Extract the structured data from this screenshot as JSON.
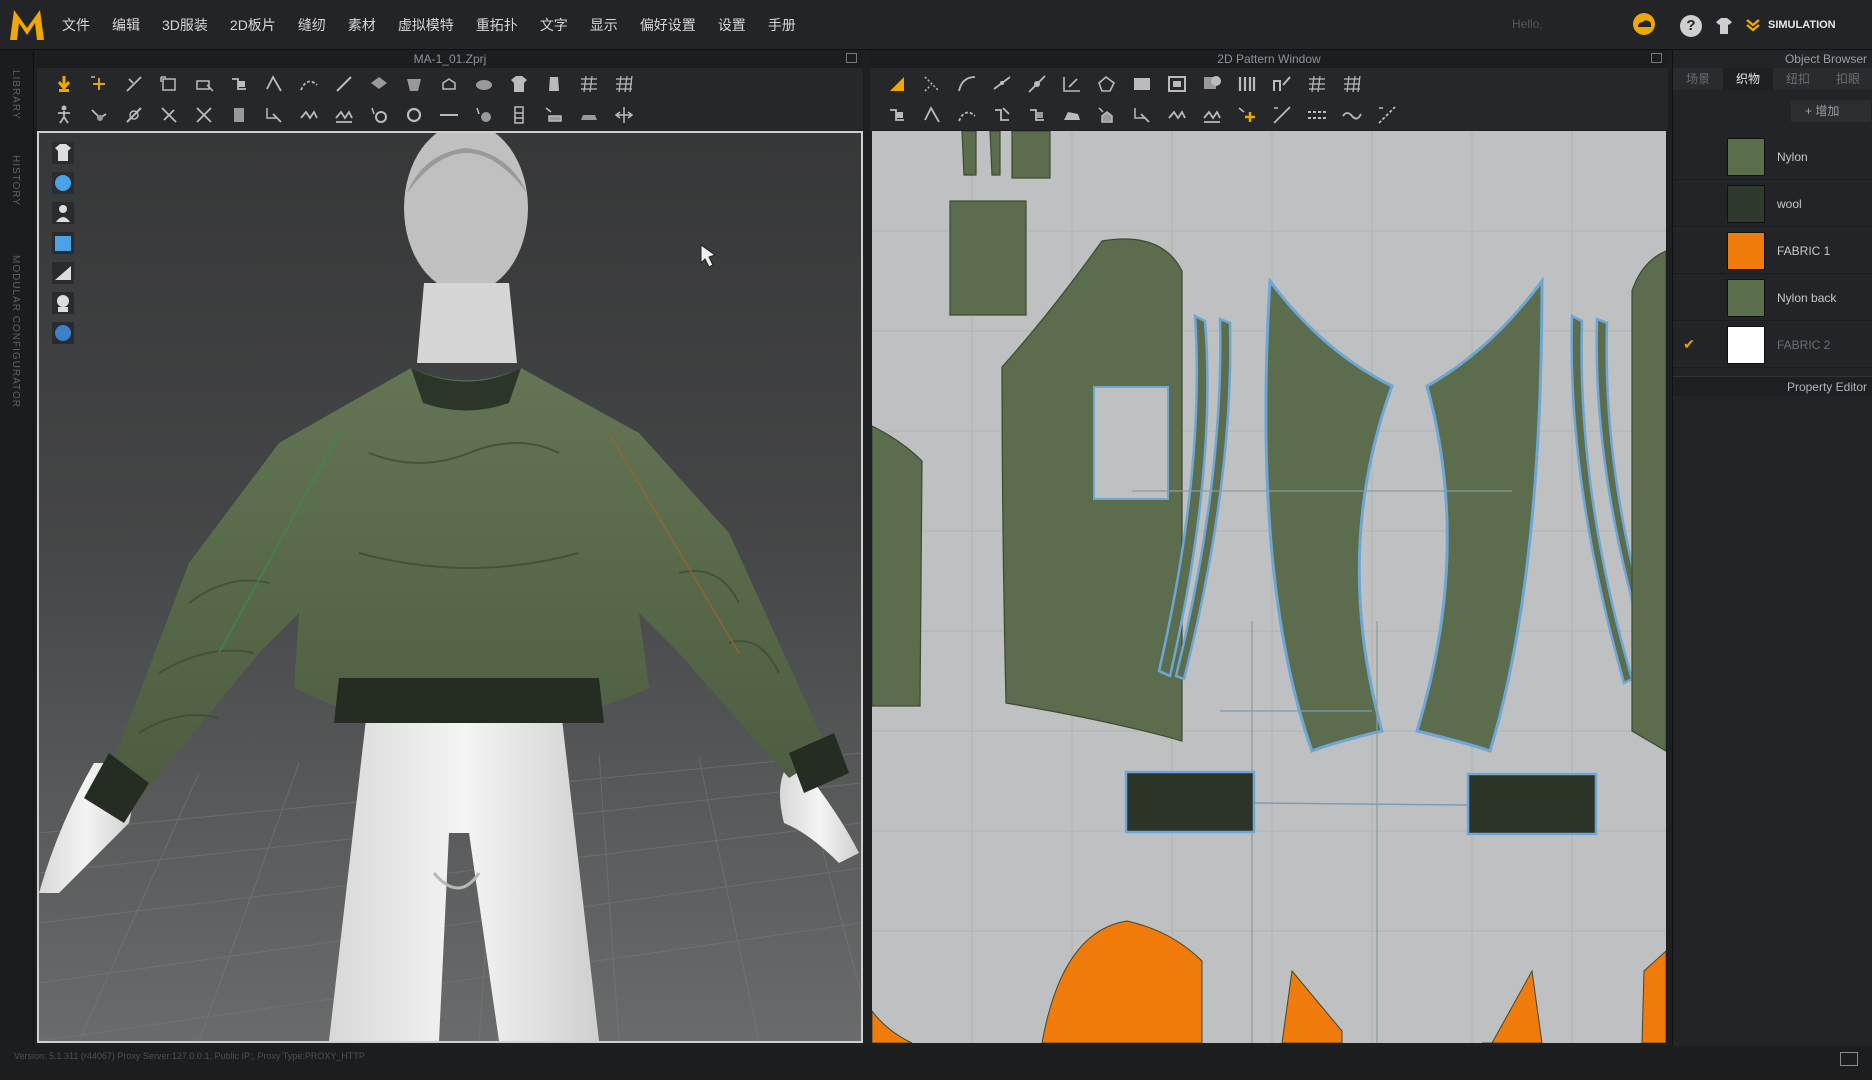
{
  "app": {
    "logo_letter": "M",
    "accent": "#f0a800"
  },
  "menu": [
    "文件",
    "编辑",
    "3D服装",
    "2D板片",
    "缝纫",
    "素材",
    "虚拟模特",
    "重拓扑",
    "文字",
    "显示",
    "偏好设置",
    "设置",
    "手册"
  ],
  "header": {
    "hello": "Hello,",
    "simulation_label": "SIMULATION"
  },
  "left_strip": {
    "library": "LIBRARY",
    "history": "HISTORY",
    "modular": "MODULAR CONFIGURATOR"
  },
  "window3d": {
    "title": "MA-1_01.Zprj"
  },
  "window2d": {
    "title": "2D Pattern Window"
  },
  "object_browser": {
    "title": "Object Browser",
    "tabs": [
      "场景",
      "织物",
      "纽扣",
      "扣眼"
    ],
    "active_tab": "织物",
    "add_label": "+ 增加",
    "fabrics": [
      {
        "name": "Nylon",
        "color": "#5a6e4c",
        "checked": false
      },
      {
        "name": "wool",
        "color": "#2e3a2c",
        "checked": false
      },
      {
        "name": "FABRIC 1",
        "color": "#f07a0a",
        "checked": false
      },
      {
        "name": "Nylon back",
        "color": "#5a6e4c",
        "checked": false
      },
      {
        "name": "FABRIC 2",
        "color": "#ffffff",
        "checked": true
      }
    ],
    "check_mark": "✔"
  },
  "property_editor": {
    "title": "Property Editor"
  },
  "status": {
    "text": "Version: 5.1.311 (r44067)   Proxy Server:127.0.0.1, Public IP:, Proxy Type:PROXY_HTTP"
  },
  "colors": {
    "garment": "#5b6d4d",
    "rib": "#2b3427",
    "orange": "#f07a0a",
    "outline": "#6ea7d6",
    "paper": "#bfc0c1"
  }
}
